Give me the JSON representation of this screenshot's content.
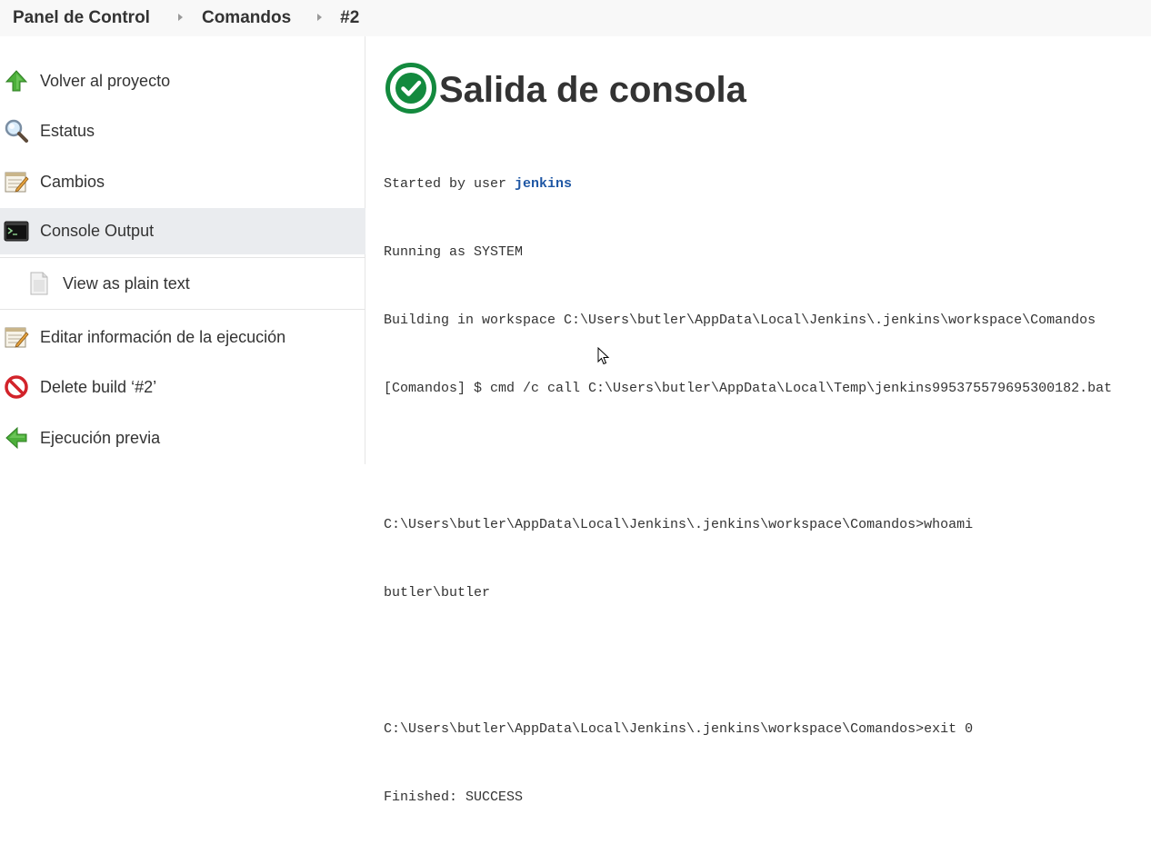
{
  "breadcrumb": {
    "items": [
      "Panel de Control",
      "Comandos",
      "#2"
    ]
  },
  "sidebar": {
    "items": [
      {
        "label": "Volver al proyecto",
        "icon": "green-up-arrow-icon"
      },
      {
        "label": "Estatus",
        "icon": "magnifier-icon"
      },
      {
        "label": "Cambios",
        "icon": "notepad-icon"
      },
      {
        "label": "Console Output",
        "icon": "terminal-icon",
        "active": true
      },
      {
        "label": "View as plain text",
        "icon": "document-icon"
      },
      {
        "label": "Editar información de la ejecución",
        "icon": "notepad-icon"
      },
      {
        "label": "Delete build ‘#2’",
        "icon": "no-entry-icon"
      },
      {
        "label": "Ejecución previa",
        "icon": "green-left-arrow-icon"
      }
    ]
  },
  "main": {
    "title": "Salida de consola",
    "status_icon": "success-check-icon",
    "console": {
      "started_prefix": "Started by user ",
      "user": "jenkins",
      "lines": [
        "Running as SYSTEM",
        "Building in workspace C:\\Users\\butler\\AppData\\Local\\Jenkins\\.jenkins\\workspace\\Comandos",
        "[Comandos] $ cmd /c call C:\\Users\\butler\\AppData\\Local\\Temp\\jenkins995375579695300182.bat",
        "",
        "C:\\Users\\butler\\AppData\\Local\\Jenkins\\.jenkins\\workspace\\Comandos>whoami",
        "butler\\butler",
        "",
        "C:\\Users\\butler\\AppData\\Local\\Jenkins\\.jenkins\\workspace\\Comandos>exit 0",
        "Finished: SUCCESS"
      ]
    }
  },
  "colors": {
    "success": "#138a3e",
    "link": "#1f57a4",
    "active_bg": "#eaecef",
    "breadcrumb_bg": "#f8f8f8"
  }
}
